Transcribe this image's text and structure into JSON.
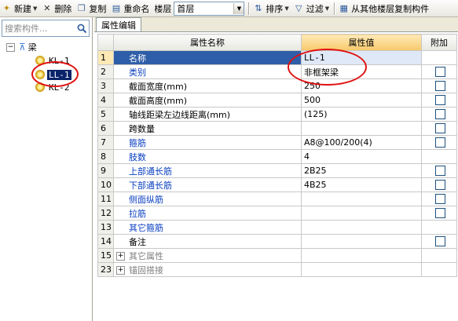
{
  "toolbar": {
    "new_label": "新建",
    "delete_label": "删除",
    "copy_label": "复制",
    "rename_label": "重命名",
    "floor_label": "楼层",
    "floor_value": "首层",
    "sort_label": "排序",
    "filter_label": "过滤",
    "copy_from_label": "从其他楼层复制构件"
  },
  "search": {
    "placeholder": "搜索构件..."
  },
  "tree": {
    "root_label": "梁",
    "items": [
      {
        "label": "KL-1"
      },
      {
        "label": "LL-1",
        "selected": true
      },
      {
        "label": "KL-2"
      }
    ]
  },
  "tab": {
    "label": "属性编辑"
  },
  "table": {
    "columns": [
      "",
      "属性名称",
      "属性值",
      "附加"
    ],
    "rows": [
      {
        "num": "1",
        "name": "名称",
        "value": "LL-1",
        "checkbox": false,
        "style": "blue",
        "selected": true
      },
      {
        "num": "2",
        "name": "类别",
        "value": "非框架梁",
        "checkbox": true,
        "style": "blue"
      },
      {
        "num": "3",
        "name": "截面宽度(mm)",
        "value": "250",
        "checkbox": true,
        "style": "black"
      },
      {
        "num": "4",
        "name": "截面高度(mm)",
        "value": "500",
        "checkbox": true,
        "style": "black"
      },
      {
        "num": "5",
        "name": "轴线距梁左边线距离(mm)",
        "value": "(125)",
        "checkbox": true,
        "style": "black"
      },
      {
        "num": "6",
        "name": "跨数量",
        "value": "",
        "checkbox": true,
        "style": "black"
      },
      {
        "num": "7",
        "name": "箍筋",
        "value": "A8@100/200(4)",
        "checkbox": true,
        "style": "blue"
      },
      {
        "num": "8",
        "name": "肢数",
        "value": "4",
        "checkbox": false,
        "style": "blue"
      },
      {
        "num": "9",
        "name": "上部通长筋",
        "value": "2B25",
        "checkbox": true,
        "style": "blue"
      },
      {
        "num": "10",
        "name": "下部通长筋",
        "value": "4B25",
        "checkbox": true,
        "style": "blue"
      },
      {
        "num": "11",
        "name": "侧面纵筋",
        "value": "",
        "checkbox": true,
        "style": "blue"
      },
      {
        "num": "12",
        "name": "拉筋",
        "value": "",
        "checkbox": true,
        "style": "blue"
      },
      {
        "num": "13",
        "name": "其它箍筋",
        "value": "",
        "checkbox": false,
        "style": "blue"
      },
      {
        "num": "14",
        "name": "备注",
        "value": "",
        "checkbox": true,
        "style": "black"
      },
      {
        "num": "15",
        "name": "其它属性",
        "value": "",
        "checkbox": false,
        "style": "gray",
        "expandable": true
      },
      {
        "num": "23",
        "name": "锚固搭接",
        "value": "",
        "checkbox": false,
        "style": "gray",
        "expandable": true
      }
    ]
  },
  "colors": {
    "annotation": "#e01010",
    "selection": "#2e5ea8",
    "blue_text": "#0a3fc0"
  },
  "icons": [
    "new-icon",
    "delete-icon",
    "copy-icon",
    "rename-icon",
    "sort-icon",
    "filter-icon",
    "copy-from-floor-icon",
    "search-icon",
    "beam-folder-icon",
    "component-gear-icon"
  ]
}
